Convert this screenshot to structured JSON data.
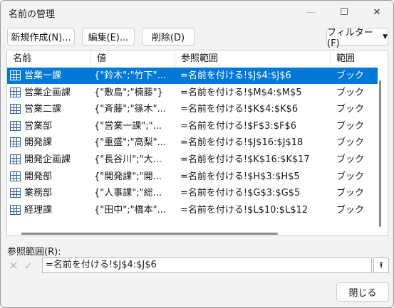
{
  "window": {
    "title": "名前の管理",
    "min_glyph": "—",
    "max_glyph": "☐",
    "close_glyph": "✕"
  },
  "toolbar": {
    "new_label": "新規作成(N)...",
    "edit_label": "編集(E)...",
    "delete_label": "削除(D)",
    "filter_label": "フィルター(F)",
    "filter_caret": "▼"
  },
  "table": {
    "headers": [
      "名前",
      "値",
      "参照範囲",
      "範囲"
    ],
    "rows": [
      {
        "name": "営業一課",
        "value": "{\"鈴木\";\"竹下\"...",
        "ref": "=名前を付ける!$J$4:$J$6",
        "scope": "ブック",
        "selected": true
      },
      {
        "name": "営業企画課",
        "value": "{\"敷島\";\"楠藤\"}",
        "ref": "=名前を付ける!$M$4:$M$5",
        "scope": "ブック"
      },
      {
        "name": "営業二課",
        "value": "{\"斉藤\";\"篠木\"...",
        "ref": "=名前を付ける!$K$4:$K$6",
        "scope": "ブック"
      },
      {
        "name": "営業部",
        "value": "{\"営業一課\";\"...",
        "ref": "=名前を付ける!$F$3:$F$6",
        "scope": "ブック"
      },
      {
        "name": "開発課",
        "value": "{\"重盛\";\"高梨\"...",
        "ref": "=名前を付ける!$J$16:$J$18",
        "scope": "ブック"
      },
      {
        "name": "開発企画課",
        "value": "{\"長谷川\";\"大...",
        "ref": "=名前を付ける!$K$16:$K$17",
        "scope": "ブック"
      },
      {
        "name": "開発部",
        "value": "{\"開発課\";\"開...",
        "ref": "=名前を付ける!$H$3:$H$5",
        "scope": "ブック"
      },
      {
        "name": "業務部",
        "value": "{\"人事課\";\"総...",
        "ref": "=名前を付ける!$G$3:$G$5",
        "scope": "ブック"
      },
      {
        "name": "経理課",
        "value": "{\"田中\";\"橋本\"...",
        "ref": "=名前を付ける!$L$10:$L$12",
        "scope": "ブック"
      }
    ]
  },
  "reference": {
    "label": "参照範囲(R):",
    "cancel_glyph": "✕",
    "ok_glyph": "✓",
    "value": "=名前を付ける!$J$4:$J$6",
    "collapse_glyph": "⭱"
  },
  "footer": {
    "close_label": "閉じる"
  }
}
